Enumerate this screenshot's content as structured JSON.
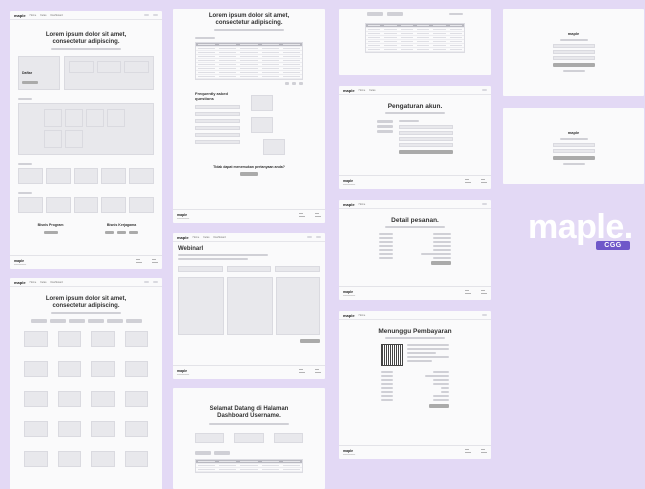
{
  "brand": "maple",
  "nav": [
    "Home",
    "Kelas",
    "Dashboard"
  ],
  "screens": {
    "landing": {
      "title": "Lorem ipsum dolor sit amet, consectetur adipiscing.",
      "hero_btn": "Daftar",
      "program_left": "Bisnis Program",
      "program_right": "Bisnis Kerjagama"
    },
    "catalog": {
      "title": "Lorem ipsum dolor sit amet, consectetur adipiscing."
    },
    "faq": {
      "title": "Lorem ipsum dolor sit amet, consectetur adipiscing.",
      "faq_heading": "Frequently asked questions",
      "cta": "Tidak dapat menemukan pertanyaan anda?"
    },
    "webinar": {
      "title": "Webinarl"
    },
    "dashboard": {
      "title": "Selamat Datang di Halaman Dashboard Username."
    },
    "settings": {
      "title": "Pengaturan akun."
    },
    "order": {
      "title": "Detail pesanan."
    },
    "payment": {
      "title": "Menunggu Pembayaran"
    }
  },
  "logo": {
    "word": "maple.",
    "tag": "CGG"
  }
}
